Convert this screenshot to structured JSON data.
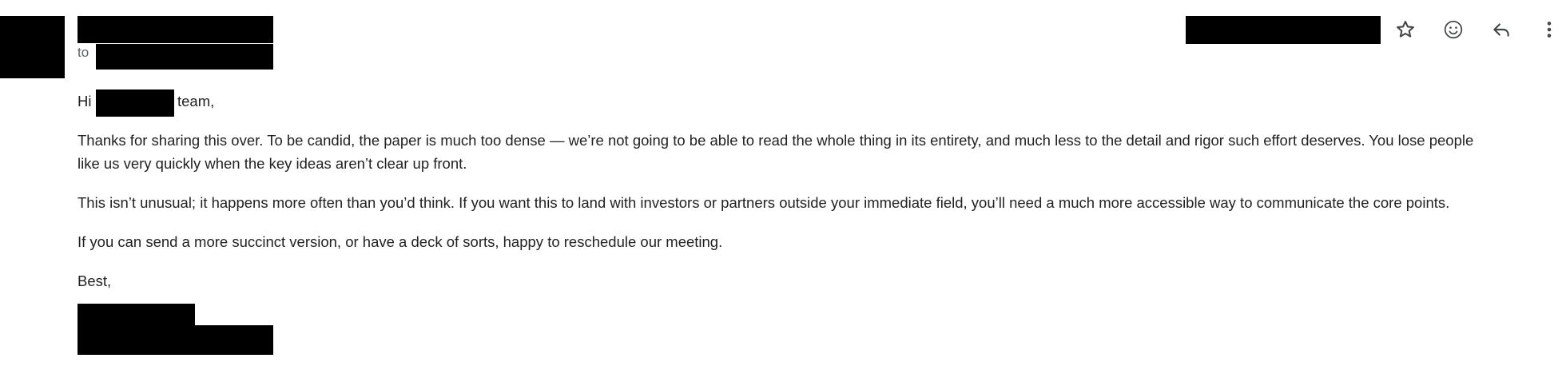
{
  "header": {
    "to_label": "to",
    "icons": {
      "star": "star-outline-icon",
      "emoji": "add-reaction-icon",
      "reply": "reply-arrow-icon",
      "more": "more-vertical-icon"
    }
  },
  "message": {
    "greeting_hi": "Hi",
    "greeting_team": "team,",
    "para1_line1": "Thanks for sharing this over. To be candid, the paper is much too dense — we’re not going to be able to read the whole thing in its entirety, and much less to the detail and rigor such effort deserves. You lose people",
    "para1_line2": "like us very quickly when the key ideas aren’t clear up front.",
    "para2": "This isn’t unusual; it happens more often than you’d think. If you want this to land with investors or partners outside your immediate field, you’ll need a much more accessible way to communicate the core points.",
    "para3": "If you can send a more succinct version, or have a deck of sorts, happy to reschedule our meeting.",
    "signoff": "Best,"
  },
  "colors": {
    "redaction": "#000000",
    "text": "#222222",
    "muted": "#5f6368",
    "icon": "#444746"
  }
}
